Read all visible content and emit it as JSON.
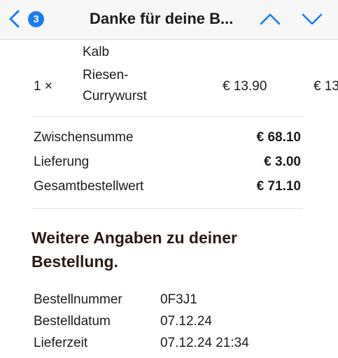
{
  "nav": {
    "unread_count": "3",
    "title": "Danke für deine B..."
  },
  "order": {
    "prev_item_detail": "Kalb",
    "item": {
      "qty": "1 ×",
      "name_line1": "Riesen-",
      "name_line2": "Currywurst",
      "price": "€ 13.90",
      "total_cut": "€ 13"
    }
  },
  "totals": [
    {
      "label": "Zwischensumme",
      "value": "€ 68.10"
    },
    {
      "label": "Lieferung",
      "value": "€ 3.00"
    },
    {
      "label": "Gesamtbestellwert",
      "value": "€ 71.10"
    }
  ],
  "details": {
    "heading": "Weitere Angaben zu deiner Bestellung.",
    "rows": [
      {
        "label": "Bestellnummer",
        "value": "0F3J1"
      },
      {
        "label": "Bestelldatum",
        "value": "07.12.24"
      },
      {
        "label": "Lieferzeit",
        "value": "07.12.24 21:34"
      }
    ]
  },
  "colors": {
    "accent": "#1a7cf4",
    "heading": "#2a1a14"
  }
}
